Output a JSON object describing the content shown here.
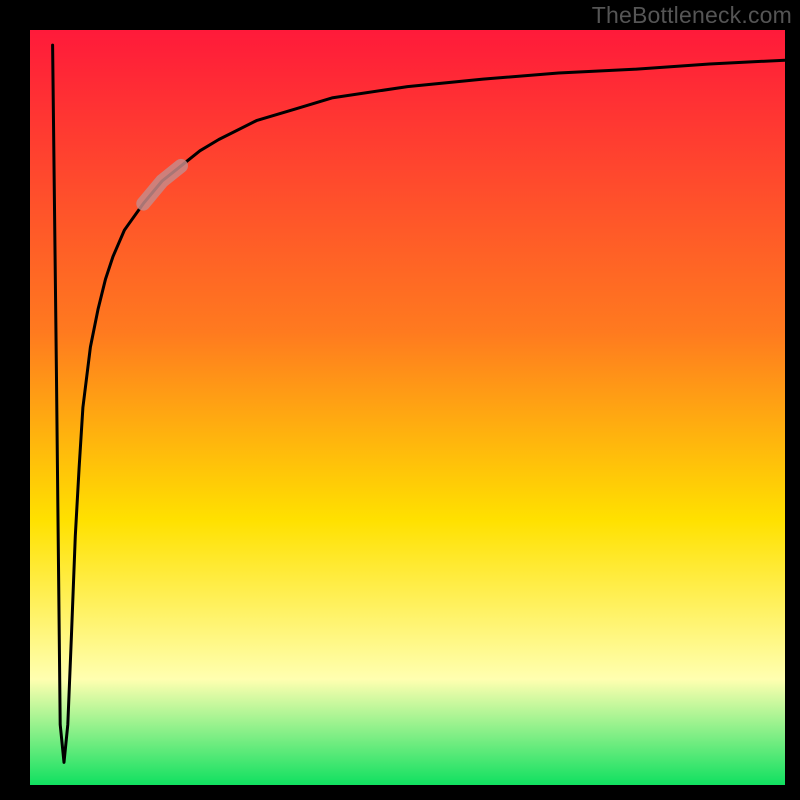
{
  "watermark": "TheBottleneck.com",
  "colors": {
    "frame": "#000000",
    "gradient_top": "#ff1a3a",
    "gradient_mid1": "#ff7a1f",
    "gradient_mid2": "#ffe100",
    "gradient_pale": "#ffffb0",
    "gradient_bottom": "#10e060",
    "curve": "#000000",
    "highlight": "#c78a88"
  },
  "chart_data": {
    "type": "line",
    "title": "",
    "xlabel": "",
    "ylabel": "",
    "xlim": [
      0,
      100
    ],
    "ylim": [
      0,
      100
    ],
    "series": [
      {
        "name": "bottleneck-curve",
        "x": [
          3,
          3.5,
          4,
          4.5,
          5,
          5.5,
          6,
          6.5,
          7,
          8,
          9,
          10,
          11,
          12.5,
          15,
          17.5,
          20,
          22.5,
          25,
          30,
          35,
          40,
          50,
          60,
          70,
          80,
          90,
          100
        ],
        "y": [
          98,
          55,
          8,
          3,
          8,
          20,
          33,
          42,
          50,
          58,
          63,
          67,
          70,
          73.5,
          77,
          80,
          82,
          84,
          85.5,
          88,
          89.5,
          91,
          92.5,
          93.5,
          94.3,
          94.8,
          95.5,
          96
        ]
      }
    ],
    "highlight_segment": {
      "series": "bottleneck-curve",
      "x_start": 15,
      "x_end": 22,
      "note": "thick pale-red overlay on curve"
    }
  }
}
